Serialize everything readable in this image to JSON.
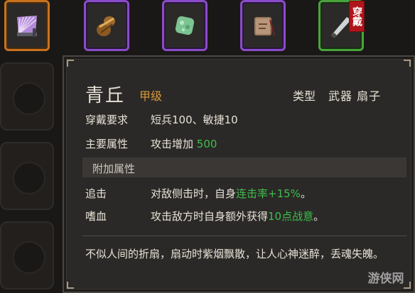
{
  "slots": [
    {
      "icon": "fan-icon",
      "rarity": "orange"
    },
    {
      "icon": "gourd-icon",
      "rarity": "purple"
    },
    {
      "icon": "jade-icon",
      "rarity": "purple"
    },
    {
      "icon": "scroll-icon",
      "rarity": "purple"
    },
    {
      "icon": "blade-icon",
      "rarity": "green",
      "tag": "穿戴"
    }
  ],
  "item": {
    "name": "青丘",
    "grade": "甲级",
    "type_label": "类型",
    "type_value": "武器 扇子",
    "requirement_label": "穿戴要求",
    "requirement_value": "短兵100、敏捷10",
    "main_attr_label": "主要属性",
    "main_attr_text": "攻击增加 ",
    "main_attr_number": "500",
    "extra_section_title": "附加属性",
    "extras": [
      {
        "name": "追击",
        "text_before": "对敌侧击时，自身",
        "highlight": "连击率+15%",
        "text_after": "。"
      },
      {
        "name": "嗜血",
        "text_before": "攻击敌方时自身额外获得",
        "highlight": "10点战意",
        "text_after": "。"
      }
    ],
    "description": "不似人间的折扇，扇动时紫烟飘散，让人心神迷醉，丢魂失魄。"
  },
  "watermark": "游侠网",
  "colors": {
    "orange_border": "#c8721e",
    "purple_border": "#8a4cc8",
    "green_border": "#4aa43c",
    "highlight_green": "#3dbf4a",
    "grade_color": "#d89a3a",
    "equip_tag": "#b0151a"
  }
}
